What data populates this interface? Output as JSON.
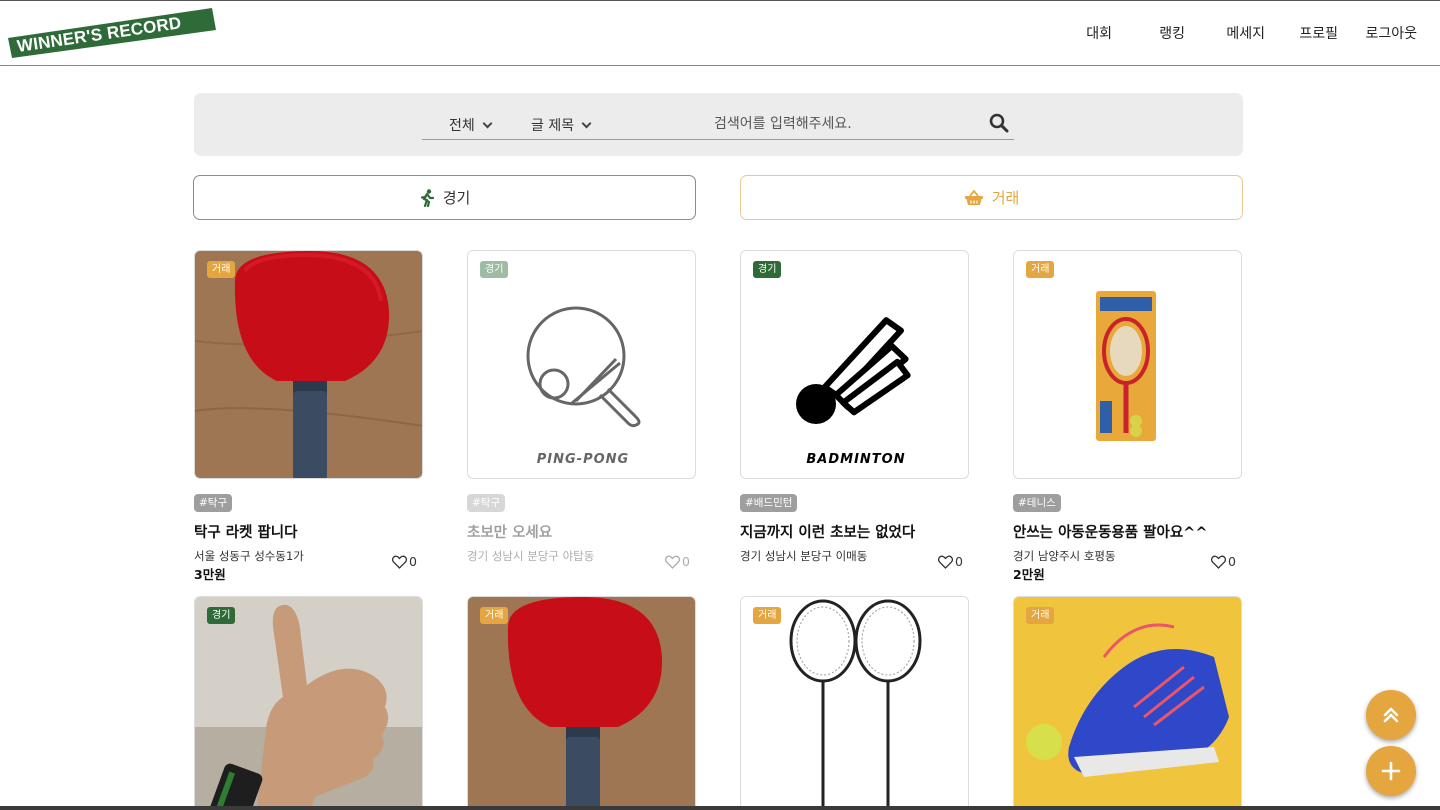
{
  "header": {
    "logo_text": "WINNER'S RECORD",
    "nav": [
      "대회",
      "랭킹",
      "메세지",
      "프로필",
      "로그아웃"
    ]
  },
  "search": {
    "scope_select": "전체",
    "field_select": "글 제목",
    "placeholder": "검색어를 입력해주세요."
  },
  "categories": {
    "match_label": "경기",
    "trade_label": "거래"
  },
  "cards": [
    {
      "badge": "거래",
      "tag": "#탁구",
      "title": "탁구 라켓 팝니다",
      "location": "서울 성동구 성수동1가",
      "price": "3만원",
      "likes": "0",
      "image": "red-paddle"
    },
    {
      "badge": "경기",
      "tag": "#탁구",
      "title": "초보만 오세요",
      "location": "경기 성남시 분당구 야탑동",
      "price": "",
      "likes": "0",
      "image": "ping-pong-icon",
      "image_label": "PING-PONG"
    },
    {
      "badge": "경기",
      "tag": "#배드민턴",
      "title": "지금까지 이런 초보는 없었다",
      "location": "경기 성남시 분당구 이매동",
      "price": "",
      "likes": "0",
      "image": "shuttlecock-icon",
      "image_label": "BADMINTON"
    },
    {
      "badge": "거래",
      "tag": "#테니스",
      "title": "안쓰는 아동운동용품 팔아요^^",
      "location": "경기 남양주시 호평동",
      "price": "2만원",
      "likes": "0",
      "image": "kids-tennis-set"
    },
    {
      "badge": "경기",
      "image": "thumbs-up"
    },
    {
      "badge": "거래",
      "image": "red-paddle"
    },
    {
      "badge": "거래",
      "image": "badminton-rackets"
    },
    {
      "badge": "거래",
      "image": "blue-sneakers"
    }
  ],
  "colors": {
    "brand_green": "#2f6b38",
    "accent_orange": "#e3a640",
    "search_bg": "#ececec"
  }
}
